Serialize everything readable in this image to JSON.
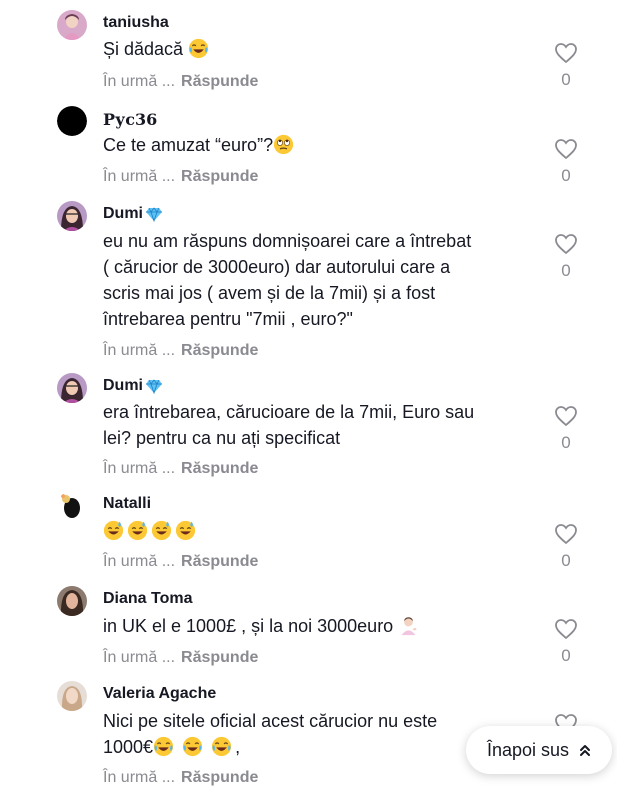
{
  "comments": [
    {
      "username": "taniusha",
      "lines": [
        "Și dădacă"
      ],
      "emojis_after": [
        "laugh-emoji"
      ],
      "time": "În urmă ...",
      "reply": "Răspunde",
      "likes": "0"
    },
    {
      "username": "Руc36",
      "lines": [
        "Ce te amuzat “euro”?"
      ],
      "emojis_after": [
        "eye-roll-emoji"
      ],
      "time": "În urmă ...",
      "reply": "Răspunde",
      "likes": "0"
    },
    {
      "username": "Dumi",
      "badge": "diamond-icon",
      "lines": [
        "eu nu am răspuns domnișoarei care a întrebat",
        "( cărucior de 3000euro) dar autorului care a",
        "scris mai jos ( avem și de la 7mii) și a fost",
        "întrebarea pentru \"7mii , euro?\""
      ],
      "time": "În urmă ...",
      "reply": "Răspunde",
      "likes": "0"
    },
    {
      "username": "Dumi",
      "badge": "diamond-icon",
      "lines": [
        "era întrebarea, cărucioare de la 7mii, Euro sau",
        "lei? pentru ca nu ați specificat"
      ],
      "time": "În urmă ...",
      "reply": "Răspunde",
      "likes": "0"
    },
    {
      "username": "Natalli",
      "lines": [
        ""
      ],
      "emojis_after": [
        "sweat-smile-emoji",
        "sweat-smile-emoji",
        "sweat-smile-emoji",
        "sweat-smile-emoji"
      ],
      "time": "În urmă ...",
      "reply": "Răspunde",
      "likes": "0"
    },
    {
      "username": "Diana Toma",
      "lines": [
        "in UK el e 1000£ , și la noi 3000euro"
      ],
      "emojis_after": [
        "woman-tipping-hand-emoji"
      ],
      "time": "În urmă ...",
      "reply": "Răspunde",
      "likes": "0"
    },
    {
      "username": "Valeria Agache",
      "lines": [
        "Nici pe sitele oficial acest cărucior nu este",
        "1000€"
      ],
      "emojis_after": [
        "laugh-emoji",
        "laugh-emoji",
        "laugh-emoji"
      ],
      "trailing": ",",
      "time": "În urmă ...",
      "reply": "Răspunde",
      "likes": ""
    }
  ],
  "back_to_top": {
    "label": "Înapoi sus",
    "icon": "double-chevron-up-icon"
  },
  "colors": {
    "text": "#161823",
    "muted": "#8a8b91",
    "badge": "#2aa5f0",
    "emoji_face": "#fcc935"
  }
}
